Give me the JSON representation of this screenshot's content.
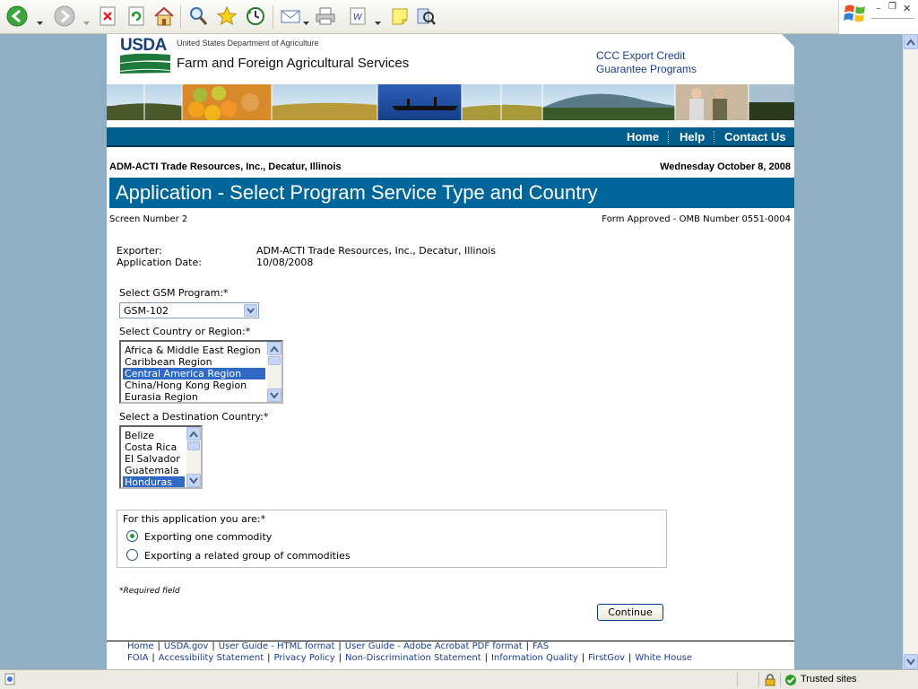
{
  "page": {
    "agency_short": "USDA",
    "department": "United States Department of Agriculture",
    "agency": "Farm and Foreign Agricultural Services",
    "program_link_line1": "CCC Export Credit",
    "program_link_line2": "Guarantee Programs",
    "nav": [
      {
        "label": "Home"
      },
      {
        "label": "Help"
      },
      {
        "label": "Contact Us"
      }
    ],
    "organization": "ADM-ACTI Trade Resources, Inc., Decatur, Illinois",
    "date": "Wednesday October 8, 2008",
    "title": "Application - Select Program Service Type and Country",
    "screen_number": "Screen Number 2",
    "omb": "Form Approved - OMB Number 0551-0004",
    "exporter_label": "Exporter:",
    "exporter_value": "ADM-ACTI Trade Resources, Inc., Decatur, Illinois",
    "app_date_label": "Application Date:",
    "app_date_value": "10/08/2008",
    "gsm_label": "Select GSM Program:*",
    "gsm_value": "GSM-102",
    "region_label": "Select Country or Region:*",
    "regions": [
      "Africa & Middle East Region",
      "Caribbean Region",
      "Central America Region",
      "China/Hong Kong Region",
      "Eurasia Region"
    ],
    "region_selected": "Central America Region",
    "destination_label": "Select a Destination Country:*",
    "countries": [
      "Belize",
      "Costa Rica",
      "El Salvador",
      "Guatemala",
      "Honduras"
    ],
    "country_selected": "Honduras",
    "radio_legend": "For this application you are:*",
    "radio_options": [
      {
        "label": "Exporting one commodity",
        "checked": true
      },
      {
        "label": "Exporting a related group of commodities",
        "checked": false
      }
    ],
    "required_note": "*Required field",
    "continue_label": "Continue",
    "footer_row1": [
      "Home",
      "USDA.gov",
      "User Guide - HTML format",
      "User Guide - Adobe Acrobat PDF format",
      "FAS"
    ],
    "footer_row2": [
      "FOIA",
      "Accessibility Statement",
      "Privacy Policy",
      "Non-Discrimination Statement",
      "Information Quality",
      "FirstGov",
      "White House"
    ]
  },
  "statusbar": {
    "zone": "Trusted sites"
  },
  "colors": {
    "nav_bg": "#005e8c",
    "title_bg": "#006699",
    "selection": "#316ac5",
    "desktop_bg": "#8fb0c4"
  }
}
